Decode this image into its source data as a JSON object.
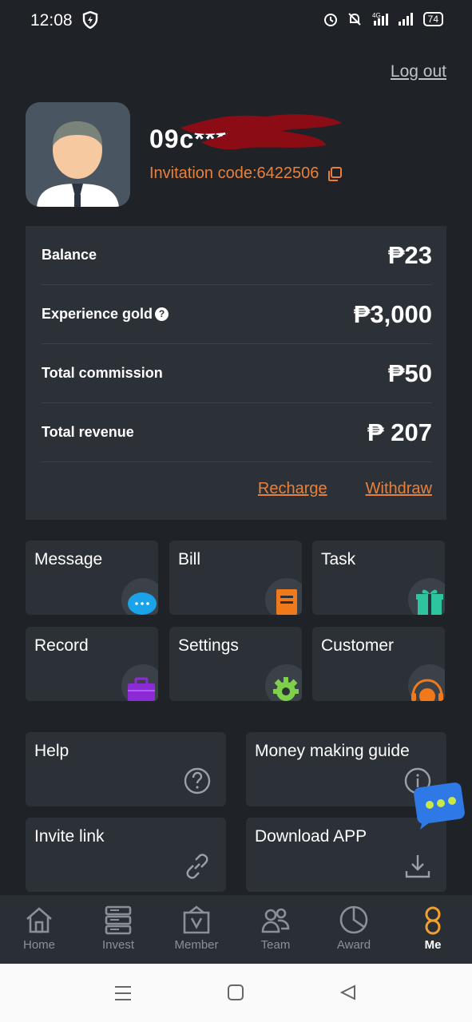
{
  "status": {
    "time": "12:08",
    "battery": "74",
    "network": "4G"
  },
  "header": {
    "logout": "Log out"
  },
  "profile": {
    "username": "09c****",
    "invitation_label": "Invitation code:",
    "invitation_code": "6422506"
  },
  "balances": [
    {
      "label": "Balance",
      "value": "₱23",
      "help": false
    },
    {
      "label": "Experience gold",
      "value": "₱3,000",
      "help": true
    },
    {
      "label": "Total commission",
      "value": "₱50",
      "help": false
    },
    {
      "label": "Total revenue",
      "value": "₱ 207",
      "help": false
    }
  ],
  "actions": {
    "recharge": "Recharge",
    "withdraw": "Withdraw"
  },
  "grid": [
    {
      "label": "Message",
      "icon": "message-icon"
    },
    {
      "label": "Bill",
      "icon": "bill-icon"
    },
    {
      "label": "Task",
      "icon": "gift-icon"
    },
    {
      "label": "Record",
      "icon": "record-icon"
    },
    {
      "label": "Settings",
      "icon": "gear-icon"
    },
    {
      "label": "Customer",
      "icon": "headset-icon"
    }
  ],
  "links": [
    {
      "label": "Help",
      "icon": "question-icon"
    },
    {
      "label": "Money making guide",
      "icon": "info-icon"
    },
    {
      "label": "Invite link",
      "icon": "link-icon"
    },
    {
      "label": "Download APP",
      "icon": "download-icon"
    }
  ],
  "tabs": [
    {
      "label": "Home",
      "icon": "home-icon"
    },
    {
      "label": "Invest",
      "icon": "server-icon"
    },
    {
      "label": "Member",
      "icon": "member-icon"
    },
    {
      "label": "Team",
      "icon": "team-icon"
    },
    {
      "label": "Award",
      "icon": "pie-icon"
    },
    {
      "label": "Me",
      "icon": "person-icon",
      "active": true
    }
  ],
  "colors": {
    "accent": "#e8803a",
    "background": "#1f2328",
    "card": "#2c3137"
  }
}
